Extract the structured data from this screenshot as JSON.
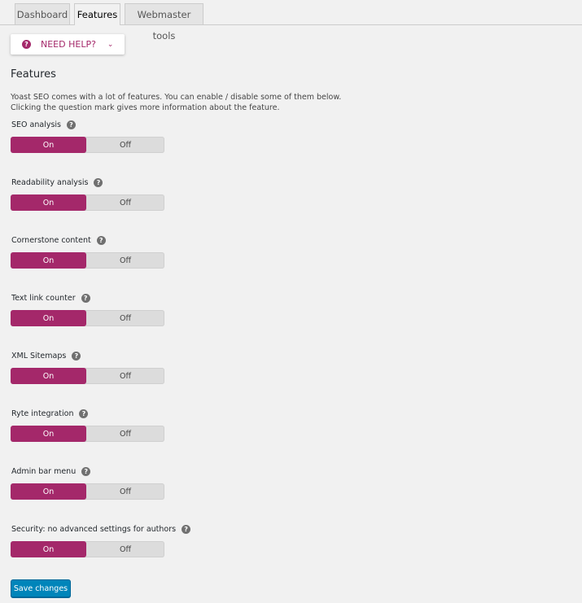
{
  "tabs": [
    {
      "label": "Dashboard",
      "active": false
    },
    {
      "label": "Features",
      "active": true
    },
    {
      "label": "Webmaster tools",
      "active": false
    }
  ],
  "help": {
    "label": "NEED HELP?",
    "icon": "question-icon",
    "chevron": "⌄"
  },
  "page": {
    "title": "Features",
    "description": "Yoast SEO comes with a lot of features. You can enable / disable some of them below. Clicking the question mark gives more information about the feature."
  },
  "features": [
    {
      "label": "SEO analysis",
      "on_label": "On",
      "off_label": "Off",
      "state": "On"
    },
    {
      "label": "Readability analysis",
      "on_label": "On",
      "off_label": "Off",
      "state": "On"
    },
    {
      "label": "Cornerstone content",
      "on_label": "On",
      "off_label": "Off",
      "state": "On"
    },
    {
      "label": "Text link counter",
      "on_label": "On",
      "off_label": "Off",
      "state": "On"
    },
    {
      "label": "XML Sitemaps",
      "on_label": "On",
      "off_label": "Off",
      "state": "On"
    },
    {
      "label": "Ryte integration",
      "on_label": "On",
      "off_label": "Off",
      "state": "On"
    },
    {
      "label": "Admin bar menu",
      "on_label": "On",
      "off_label": "Off",
      "state": "On"
    },
    {
      "label": "Security: no advanced settings for authors",
      "on_label": "On",
      "off_label": "Off",
      "state": "On"
    }
  ],
  "question_glyph": "?",
  "save": {
    "label": "Save changes"
  },
  "colors": {
    "accent": "#a4286a",
    "primary_button": "#0085ba",
    "background": "#f1f1f1"
  }
}
